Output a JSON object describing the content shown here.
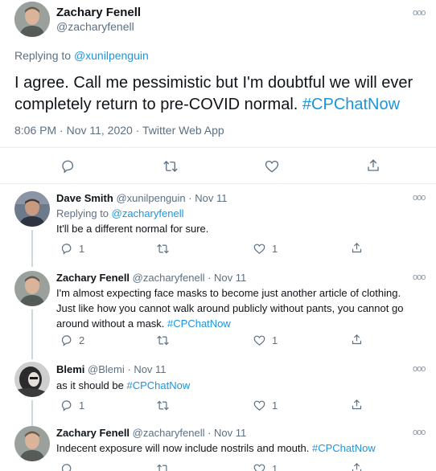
{
  "main_tweet": {
    "name": "Zachary Fenell",
    "handle": "@zacharyfenell",
    "replying_prefix": "Replying to",
    "replying_to": "@xunilpenguin",
    "text": "I agree. Call me pessimistic but I'm doubtful we will ever completely return to pre-COVID normal.",
    "hashtag": "#CPChatNow",
    "timestamp": "8:06 PM · Nov 11, 2020",
    "source": "Twitter Web App"
  },
  "replies": [
    {
      "name": "Dave Smith",
      "handle": "@xunilpenguin",
      "date": "Nov 11",
      "replying_prefix": "Replying to",
      "replying_to": "@zacharyfenell",
      "text": "It'll be a different normal for sure.",
      "hashtag": "",
      "reply_count": "1",
      "like_count": "1"
    },
    {
      "name": "Zachary Fenell",
      "handle": "@zacharyfenell",
      "date": "Nov 11",
      "text": "I'm almost expecting face masks to become just another article of clothing. Just like how you cannot walk around publicly without pants, you cannot go around without a mask.",
      "hashtag": "#CPChatNow",
      "reply_count": "2",
      "like_count": "1"
    },
    {
      "name": "Blemi",
      "handle": "@Blemi",
      "date": "Nov 11",
      "text": "as it should be",
      "hashtag": "#CPChatNow",
      "reply_count": "1",
      "like_count": "1"
    },
    {
      "name": "Zachary Fenell",
      "handle": "@zacharyfenell",
      "date": "Nov 11",
      "text": "Indecent exposure will now include nostrils and mouth.",
      "hashtag": "#CPChatNow",
      "reply_count": "",
      "like_count": "1"
    }
  ],
  "icons": {
    "reply": "reply-icon",
    "retweet": "retweet-icon",
    "like": "heart-icon",
    "share": "share-icon",
    "more": "more-icon"
  },
  "colors": {
    "link": "#1b95e0",
    "muted": "#5b7083",
    "divider": "#e6ecf0"
  }
}
